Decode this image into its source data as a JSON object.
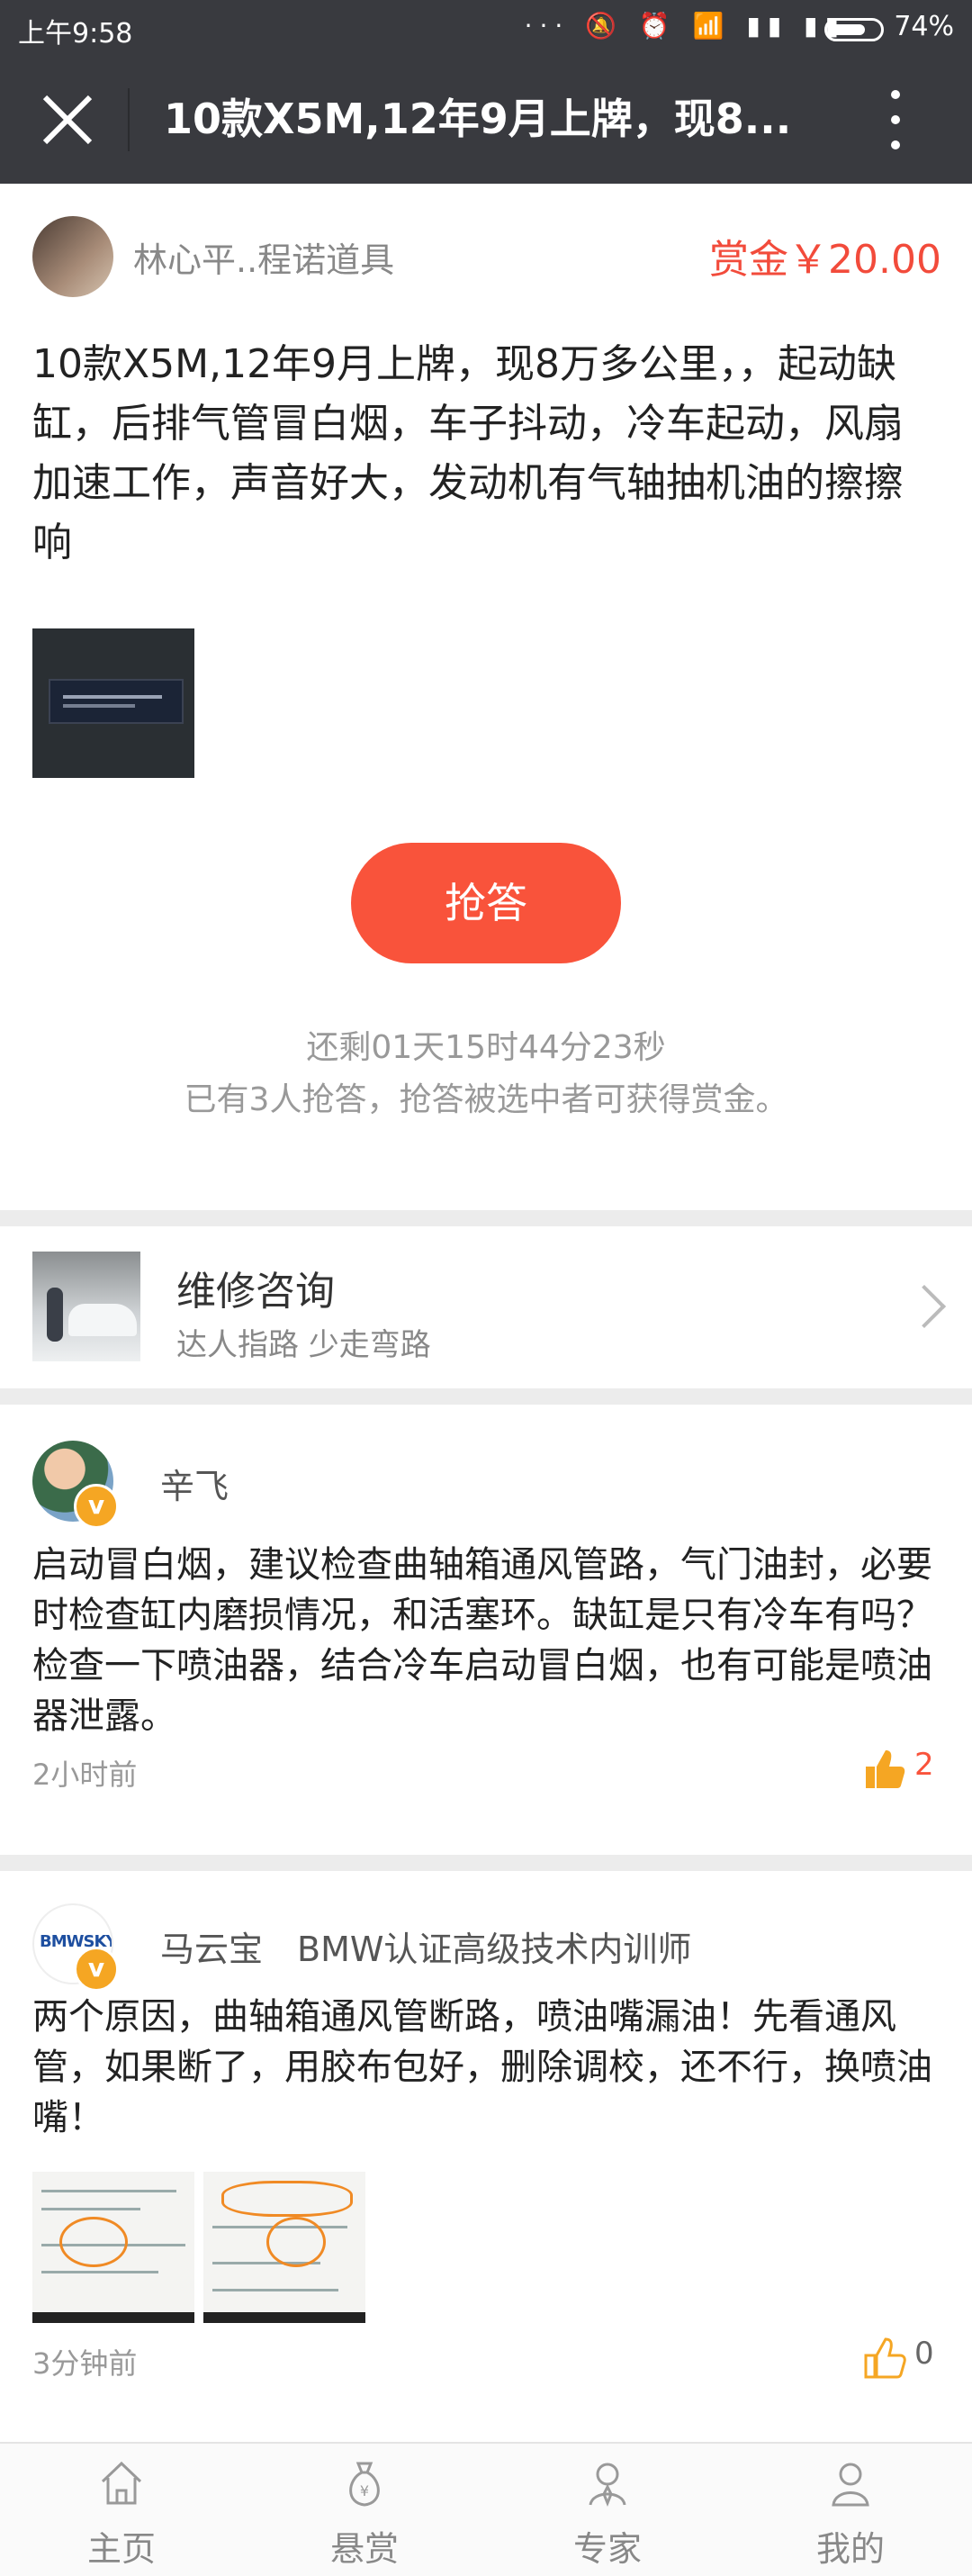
{
  "status_bar": {
    "time": "上午9:58",
    "icons": "··· 🔕 ⏰ 📶 ▮▮ ▮▮",
    "battery_level": 0.74,
    "battery": "74%"
  },
  "title_bar": {
    "title": "10款X5M,12年9月上牌，现8..."
  },
  "question": {
    "asker_name": "林心平..程诺道具",
    "reward": "赏金￥20.00",
    "text": "10款X5M,12年9月上牌，现8万多公里，，起动缺缸，后排气管冒白烟，车子抖动，冷车起动，风扇加速工作，声音好大，发动机有气轴抽机油的擦擦响",
    "grab_button": "抢答",
    "countdown": "还剩01天15时44分23秒",
    "note": "已有3人抢答，抢答被选中者可获得赏金。"
  },
  "consult": {
    "title": "维修咨询",
    "subtitle": "达人指路 少走弯路"
  },
  "answers": [
    {
      "name": "辛飞",
      "badge": "v",
      "text": "启动冒白烟，建议检查曲轴箱通风管路，气门油封，必要时检查缸内磨损情况，和活塞环。缺缸是只有冷车有吗？检查一下喷油器，结合冷车启动冒白烟，也有可能是喷油器泄露。",
      "time": "2小时前",
      "likes": "2"
    },
    {
      "name": "马云宝　BMW认证高级技术内训师",
      "avatar_text": "BMWSKY",
      "badge": "v",
      "text": "两个原因，曲轴箱通风管断路，喷油嘴漏油！先看通风管，如果断了，用胶布包好，删除调校，还不行，换喷油嘴！",
      "time": "3分钟前",
      "likes": "0"
    }
  ],
  "tabbar": {
    "items": [
      "主页",
      "悬赏",
      "专家",
      "我的"
    ]
  },
  "colors": {
    "accent": "#f9533b",
    "header_bg": "#393a3f",
    "like_orange": "#f5a623"
  }
}
